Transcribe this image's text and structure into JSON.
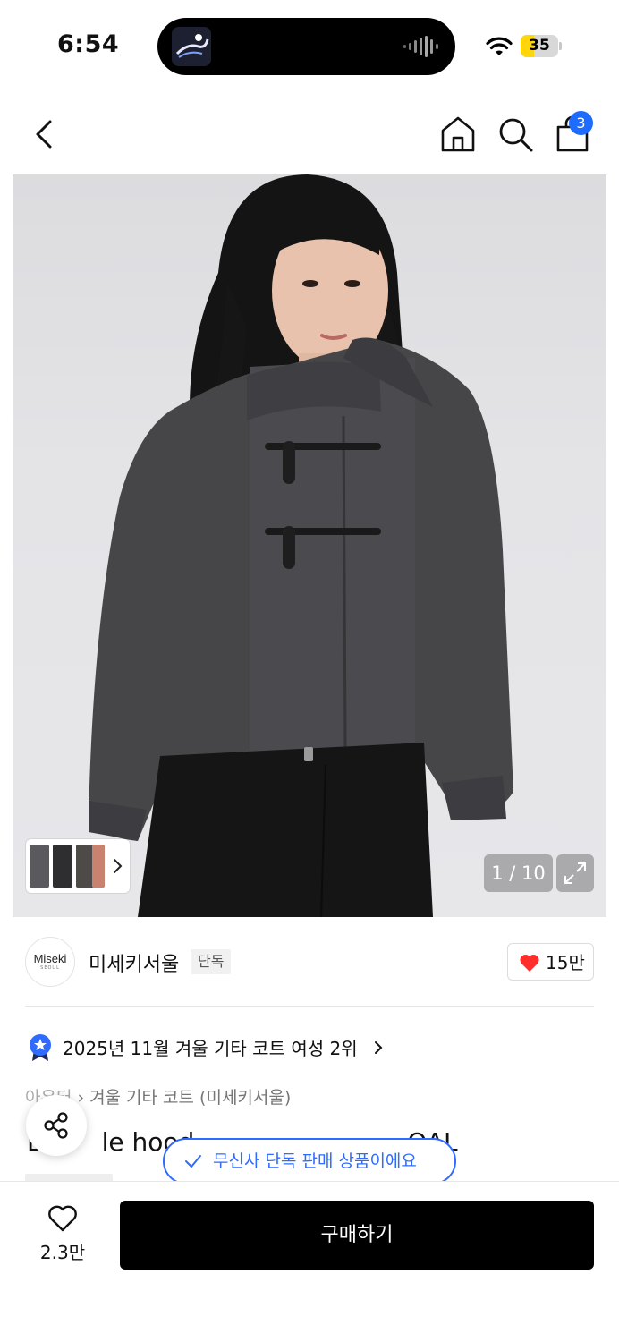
{
  "status_bar": {
    "time": "6:54",
    "battery_level": "35",
    "battery_fraction": 0.35,
    "battery_color": "#ffd60a"
  },
  "nav": {
    "cart_count": "3",
    "icons": [
      "back-icon",
      "home-icon",
      "search-icon",
      "cart-icon"
    ]
  },
  "gallery": {
    "counter": "1 / 10"
  },
  "brand": {
    "logo_text": "Miseki",
    "logo_subtext": "SEOUL",
    "name": "미세키서울",
    "exclusive_label": "단독",
    "likes": "15만"
  },
  "ranking": {
    "text": "2025년 11월 겨울 기타 코트 여성 2위"
  },
  "breadcrumb": {
    "first": "아우터",
    "second": "겨울 기타 코트 (미세키서울)"
  },
  "product": {
    "title_left": "D",
    "title_mid": "le hood",
    "title_right": "OAL"
  },
  "toast": {
    "text": "무신사 단독 판매 상품이에요"
  },
  "bottom_bar": {
    "wish_count": "2.3만",
    "buy_label": "구매하기"
  },
  "colors": {
    "accent_blue": "#1e6bff",
    "toast_blue": "#2f6bff",
    "heart_red": "#ff2d2d"
  }
}
